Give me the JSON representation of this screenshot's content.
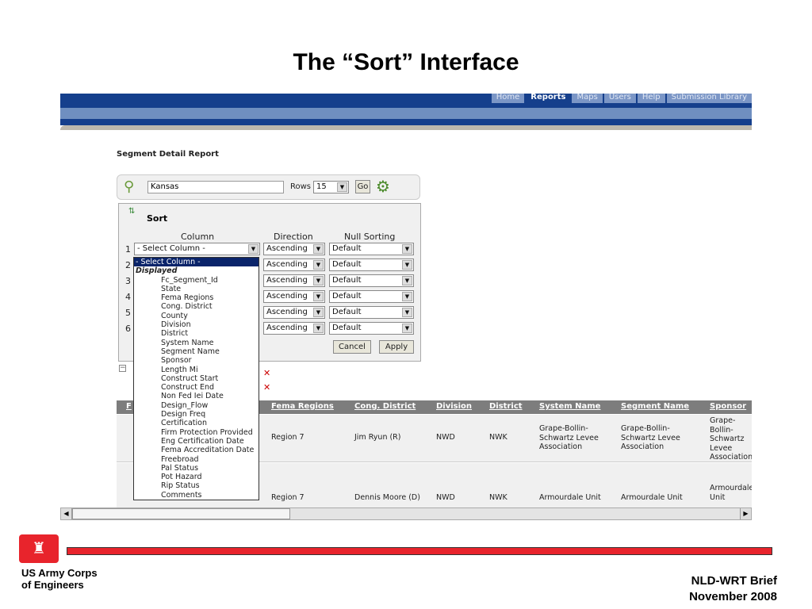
{
  "slide_title": "The “Sort” Interface",
  "nav": {
    "tabs": [
      "Home",
      "Reports",
      "Maps",
      "Users",
      "Help",
      "Submission Library"
    ],
    "active": "Reports"
  },
  "report_title": "Segment Detail Report",
  "search": {
    "value": "Kansas",
    "rows_label": "Rows",
    "rows_value": "15",
    "go_label": "Go"
  },
  "sort": {
    "title": "Sort",
    "col_header": "Column",
    "dir_header": "Direction",
    "null_header": "Null Sorting",
    "rows": [
      {
        "n": "1",
        "column": "- Select Column -",
        "direction": "Ascending",
        "nulls": "Default"
      },
      {
        "n": "2",
        "direction": "Ascending",
        "nulls": "Default"
      },
      {
        "n": "3",
        "direction": "Ascending",
        "nulls": "Default"
      },
      {
        "n": "4",
        "direction": "Ascending",
        "nulls": "Default"
      },
      {
        "n": "5",
        "direction": "Ascending",
        "nulls": "Default"
      },
      {
        "n": "6",
        "direction": "Ascending",
        "nulls": "Default"
      }
    ],
    "cancel_label": "Cancel",
    "apply_label": "Apply"
  },
  "dropdown": {
    "selected": "- Select Column -",
    "group": "Displayed",
    "options": [
      "Fc_Segment_Id",
      "State",
      "Fema Regions",
      "Cong. District",
      "County",
      "Division",
      "District",
      "System Name",
      "Segment Name",
      "Sponsor",
      "Length Mi",
      "Construct Start",
      "Construct End",
      "Non Fed Iei Date",
      "Design_Flow",
      "Design Freq",
      "Certification",
      "Firm Protection Provided",
      "Eng Certification Date",
      "Fema Accreditation Date",
      "Freebroad",
      "Pal Status",
      "Pot Hazard",
      "Rip Status",
      "Comments"
    ]
  },
  "table": {
    "headers": [
      "F",
      "Fema Regions",
      "Cong. District",
      "Division",
      "District",
      "System Name",
      "Segment Name",
      "Sponsor"
    ],
    "rows": [
      [
        "Region 7",
        "Jim Ryun (R)",
        "NWD",
        "NWK",
        "Grape-Bollin-Schwartz Levee Association",
        "Grape-Bollin-Schwartz Levee Association",
        "Grape-Bollin-Schwartz Levee Association"
      ],
      [
        "Region 7",
        "Dennis Moore (D)",
        "NWD",
        "NWK",
        "Armourdale Unit",
        "Armourdale Unit",
        "Armourdale Unit"
      ]
    ]
  },
  "footer": {
    "org_line1": "US Army Corps",
    "org_line2": "of Engineers",
    "brief": "NLD-WRT Brief",
    "date": "November 2008"
  },
  "colors": {
    "nav_dark": "#153f8c",
    "nav_light": "#6f8fc0",
    "footer_red": "#e8242c"
  }
}
